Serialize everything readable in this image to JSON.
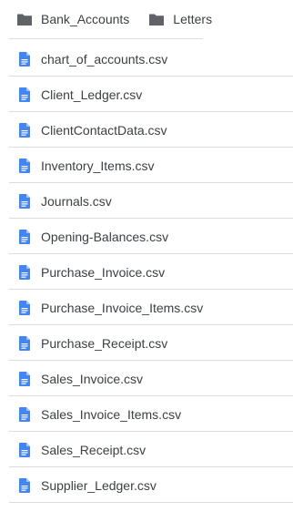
{
  "folders": [
    {
      "label": "Bank_Accounts",
      "icon": "folder-icon"
    },
    {
      "label": "Letters",
      "icon": "folder-icon"
    }
  ],
  "files": [
    {
      "label": "chart_of_accounts.csv",
      "icon": "document-icon"
    },
    {
      "label": "Client_Ledger.csv",
      "icon": "document-icon"
    },
    {
      "label": "ClientContactData.csv",
      "icon": "document-icon"
    },
    {
      "label": "Inventory_Items.csv",
      "icon": "document-icon"
    },
    {
      "label": "Journals.csv",
      "icon": "document-icon"
    },
    {
      "label": "Opening-Balances.csv",
      "icon": "document-icon"
    },
    {
      "label": "Purchase_Invoice.csv",
      "icon": "document-icon"
    },
    {
      "label": "Purchase_Invoice_Items.csv",
      "icon": "document-icon"
    },
    {
      "label": "Purchase_Receipt.csv",
      "icon": "document-icon"
    },
    {
      "label": "Sales_Invoice.csv",
      "icon": "document-icon"
    },
    {
      "label": "Sales_Invoice_Items.csv",
      "icon": "document-icon"
    },
    {
      "label": "Sales_Receipt.csv",
      "icon": "document-icon"
    },
    {
      "label": "Supplier_Ledger.csv",
      "icon": "document-icon"
    }
  ],
  "colors": {
    "folder": "#5f6368",
    "document": "#4285f4",
    "divider": "#dadce0",
    "text": "#3c4043"
  }
}
